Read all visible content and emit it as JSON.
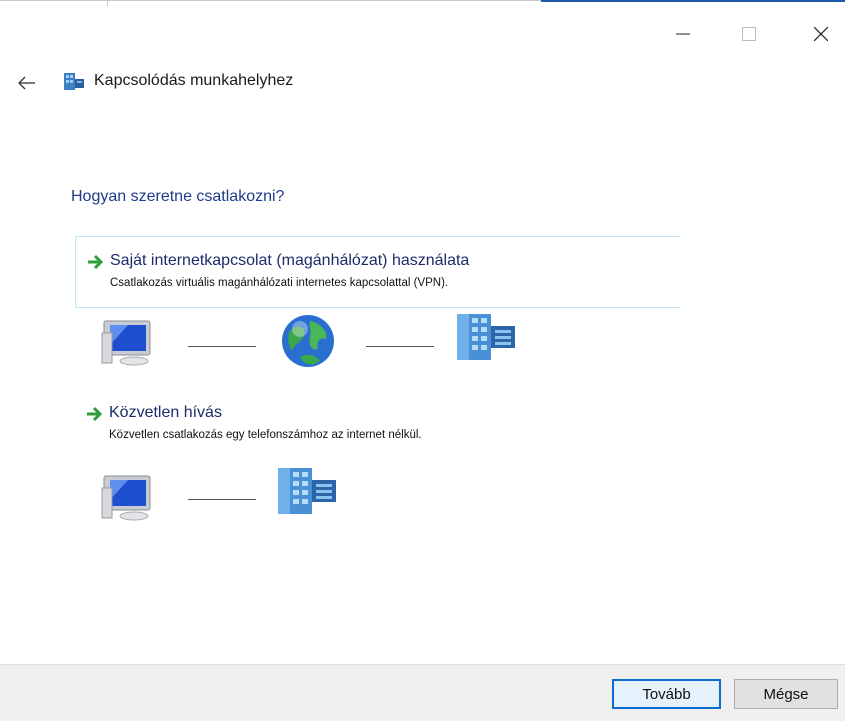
{
  "window": {
    "title": "Kapcsolódás munkahelyhez",
    "controls": [
      "minimize-icon",
      "maximize-icon",
      "close-icon"
    ]
  },
  "nav": {
    "back_icon": "arrow-left-icon"
  },
  "main": {
    "heading": "Hogyan szeretne csatlakozni?",
    "options": [
      {
        "title": "Saját internetkapcsolat (magánhálózat) használata",
        "description": "Csatlakozás virtuális magánhálózati internetes kapcsolattal (VPN).",
        "selected": true,
        "diagram_icons": [
          "computer-icon",
          "globe-icon",
          "office-building-icon"
        ]
      },
      {
        "title": "Közvetlen hívás",
        "description": "Közvetlen csatlakozás egy telefonszámhoz az internet nélkül.",
        "selected": false,
        "diagram_icons": [
          "computer-icon",
          "office-building-icon"
        ]
      }
    ]
  },
  "footer": {
    "next_label": "Tovább",
    "cancel_label": "Mégse"
  },
  "colors": {
    "heading": "#1e3a8a",
    "accent": "#0a6ed1",
    "selection_border": "#bde6f2",
    "footer_bg": "#f0f0f0",
    "arrow_green": "#2e9e3a"
  }
}
